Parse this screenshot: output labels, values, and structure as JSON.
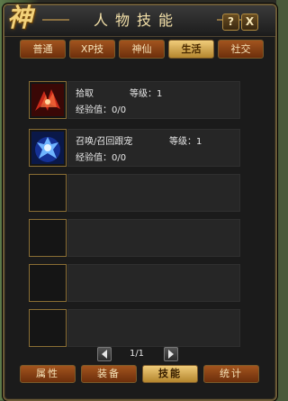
{
  "window": {
    "emblem": "神",
    "title": "人物技能",
    "help_label": "?",
    "close_label": "X"
  },
  "top_tabs": [
    {
      "label": "普通",
      "active": false
    },
    {
      "label": "XP技",
      "active": false
    },
    {
      "label": "神仙",
      "active": false
    },
    {
      "label": "生活",
      "active": true
    },
    {
      "label": "社交",
      "active": false
    }
  ],
  "skills": [
    {
      "name": "拾取",
      "level_label": "等级：1",
      "exp_label": "经验值：0/0",
      "icon": "red-wings-icon"
    },
    {
      "name": "召唤/召回跟宠",
      "level_label": "等级：1",
      "exp_label": "经验值：0/0",
      "icon": "blue-summon-icon"
    },
    {
      "name": "",
      "level_label": "",
      "exp_label": "",
      "icon": ""
    },
    {
      "name": "",
      "level_label": "",
      "exp_label": "",
      "icon": ""
    },
    {
      "name": "",
      "level_label": "",
      "exp_label": "",
      "icon": ""
    },
    {
      "name": "",
      "level_label": "",
      "exp_label": "",
      "icon": ""
    }
  ],
  "pager": {
    "text": "1/1"
  },
  "bottom_tabs": [
    {
      "label": "属性",
      "active": false
    },
    {
      "label": "装备",
      "active": false
    },
    {
      "label": "技能",
      "active": true
    },
    {
      "label": "统计",
      "active": false
    }
  ]
}
